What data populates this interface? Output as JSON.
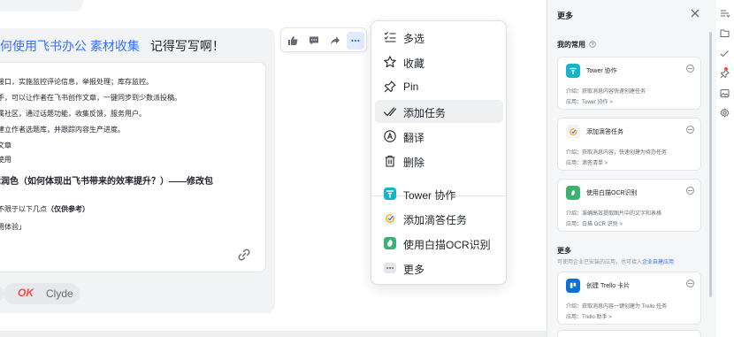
{
  "message": {
    "title_link": "何使用飞书办公 素材收集",
    "title_text": "记得写写啊！",
    "doc_lines": [
      "器人接口，实施监控评论信息，举报处理；库存监控。",
      "步助手，可以让作者在飞书创作文章，一键同步到少数派投稿。",
      "费专属社区，通过话题功能，收集反馈，服务用户。",
      "表格建立作者选题库，并跟踪内容生产进度。",
      "发送文章",
      "己的使用"
    ],
    "doc_heading": "编辑润色（如何体现出飞书带来的效率提升？）——修改包",
    "doc_note_prefix": "括但不限于以下几点",
    "doc_note_bold": "（仅供参考）",
    "doc_note_last": "度使用体验」",
    "reaction_emoji": "OK",
    "reaction_user": "Clyde"
  },
  "toolbar": {
    "icons": [
      "thumbs-up-icon",
      "comment-icon",
      "forward-icon",
      "more-icon"
    ]
  },
  "menu": {
    "items": [
      {
        "label": "多选",
        "icon": "multi-select-icon"
      },
      {
        "label": "收藏",
        "icon": "star-icon"
      },
      {
        "label": "Pin",
        "icon": "pin-icon"
      },
      {
        "label": "添加任务",
        "icon": "task-check-icon"
      },
      {
        "label": "翻译",
        "icon": "translate-icon"
      },
      {
        "label": "删除",
        "icon": "trash-icon"
      },
      {
        "label": "Tower 协作",
        "icon": "tower-icon"
      },
      {
        "label": "添加滴答任务",
        "icon": "ticktick-icon"
      },
      {
        "label": "使用白描OCR识别",
        "icon": "ocr-icon"
      },
      {
        "label": "更多",
        "icon": "ellipsis-icon"
      }
    ]
  },
  "panel": {
    "title": "更多",
    "favorites_title": "我的常用",
    "more_title": "更多",
    "more_sub_prefix": "可使用企业已安装的应用，也可接入",
    "more_sub_link": "企业自建应用",
    "cards": [
      {
        "name": "Tower 协作",
        "desc": "介绍：获取消息内容快速创建任务",
        "app": "应用：Tower 协作 >"
      },
      {
        "name": "添加滴答任务",
        "desc": "介绍：获取消息内容，快速创建为待办任务",
        "app": "应用：滴答清单 >"
      },
      {
        "name": "使用白描OCR识别",
        "desc": "介绍：准确高效提取图片中的文字和表格",
        "app": "应用：白描 OCR 识别 >"
      },
      {
        "name": "创建 Trello 卡片",
        "desc": "介绍：获取消息内容一键创建为 Trello 任务",
        "app": "应用：Trello 助手 >"
      }
    ]
  },
  "colors": {
    "accent": "#3370ff",
    "tower": "#16b3c9",
    "ocr": "#3bb273",
    "trello": "#0a6fd6",
    "danger": "#f54a45"
  }
}
